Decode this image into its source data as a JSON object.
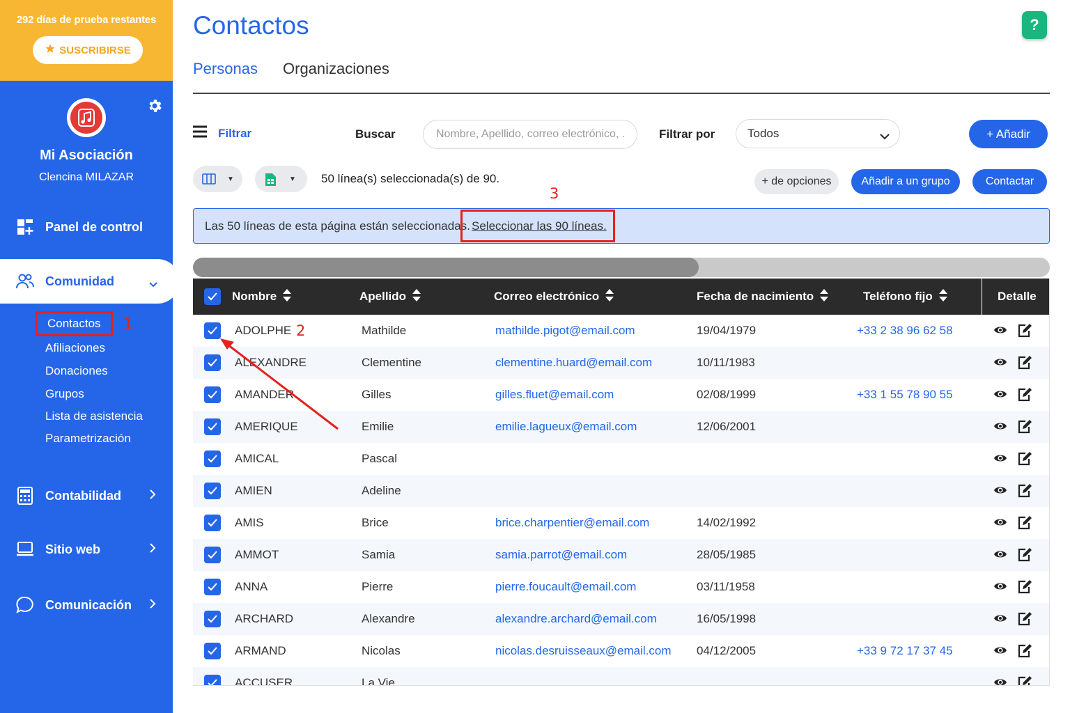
{
  "trial": {
    "text": "292 días de prueba restantes",
    "subscribe_label": "SUSCRIBIRSE"
  },
  "org": {
    "name": "Mi Asociación",
    "user": "Clencina MILAZAR"
  },
  "menu": {
    "panel": "Panel de control",
    "comunidad": "Comunidad",
    "contabilidad": "Contabilidad",
    "sitio": "Sitio web",
    "comunicacion": "Comunicación",
    "sub": [
      "Contactos",
      "Afiliaciones",
      "Donaciones",
      "Grupos",
      "Lista de asistencia",
      "Parametrización"
    ]
  },
  "annotations": {
    "n1": "1",
    "n2": "2",
    "n3": "3",
    "color": "#e3221b"
  },
  "page": {
    "title": "Contactos",
    "help": "?"
  },
  "tabs": [
    "Personas",
    "Organizaciones"
  ],
  "toolbar": {
    "filter_label": "Filtrar",
    "search_label": "Buscar",
    "search_placeholder": "Nombre, Apellido, correo electrónico, ...",
    "filter_by_label": "Filtrar por",
    "filter_value": "Todos",
    "add_label": "+ Añadir",
    "selection_text": "50 línea(s) seleccionada(s) de 90.",
    "more_label": "+ de opciones",
    "group_label": "Añadir a un grupo",
    "contact_label": "Contactar"
  },
  "banner": {
    "text": "Las 50 líneas de esta página están seleccionadas.",
    "link": "Seleccionar las 90 líneas."
  },
  "colors": {
    "primary": "#2566e8",
    "trial": "#f8b733",
    "help": "#1bb67e",
    "header": "#2b2b2b"
  },
  "table": {
    "headers": [
      "Nombre",
      "Apellido",
      "Correo electrónico",
      "Fecha de nacimiento",
      "Teléfono fijo",
      "Detalle"
    ],
    "rows": [
      [
        "ADOLPHE",
        "Mathilde",
        "mathilde.pigot@email.com",
        "19/04/1979",
        "+33 2 38 96 62 58"
      ],
      [
        "ALEXANDRE",
        "Clementine",
        "clementine.huard@email.com",
        "10/11/1983",
        ""
      ],
      [
        "AMANDER",
        "Gilles",
        "gilles.fluet@email.com",
        "02/08/1999",
        "+33 1 55 78 90 55"
      ],
      [
        "AMERIQUE",
        "Emilie",
        "emilie.lagueux@email.com",
        "12/06/2001",
        ""
      ],
      [
        "AMICAL",
        "Pascal",
        "",
        "",
        ""
      ],
      [
        "AMIEN",
        "Adeline",
        "",
        "",
        ""
      ],
      [
        "AMIS",
        "Brice",
        "brice.charpentier@email.com",
        "14/02/1992",
        ""
      ],
      [
        "AMMOT",
        "Samia",
        "samia.parrot@email.com",
        "28/05/1985",
        ""
      ],
      [
        "ANNA",
        "Pierre",
        "pierre.foucault@email.com",
        "03/11/1958",
        ""
      ],
      [
        "ARCHARD",
        "Alexandre",
        "alexandre.archard@email.com",
        "16/05/1998",
        ""
      ],
      [
        "ARMAND",
        "Nicolas",
        "nicolas.desruisseaux@email.com",
        "04/12/2005",
        "+33 9 72 17 37 45"
      ],
      [
        "ACCUSER",
        "La Vie",
        "",
        "",
        ""
      ]
    ]
  }
}
